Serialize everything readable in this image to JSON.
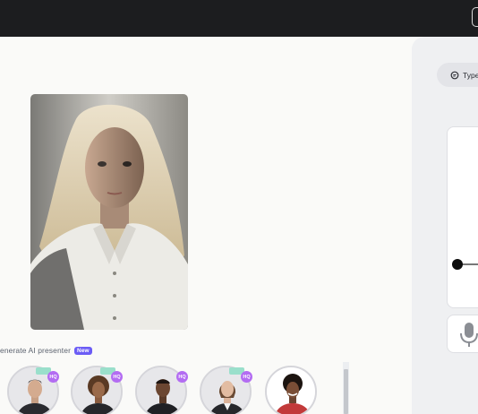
{
  "header": {
    "action_chip_label": ""
  },
  "stage": {
    "generate_label": "enerate AI presenter",
    "new_badge": "New"
  },
  "presenters": [
    {
      "name": "presenter-1",
      "hq": "HQ",
      "has_tag": true
    },
    {
      "name": "presenter-2",
      "hq": "HQ",
      "has_tag": true
    },
    {
      "name": "presenter-3",
      "hq": "HQ",
      "has_tag": false
    },
    {
      "name": "presenter-4",
      "hq": "HQ",
      "has_tag": true
    },
    {
      "name": "presenter-5",
      "hq": "",
      "has_tag": false
    }
  ],
  "panel": {
    "type_tab_label": "Type"
  },
  "colors": {
    "topbar": "#1c1d1f",
    "accent": "#6b5cf5",
    "hq_badge": "#b36cf2",
    "panel_bg": "#eff0f2"
  },
  "icons": {
    "type_tab": "chat-bubble-icon",
    "voice": "microphone-icon"
  }
}
